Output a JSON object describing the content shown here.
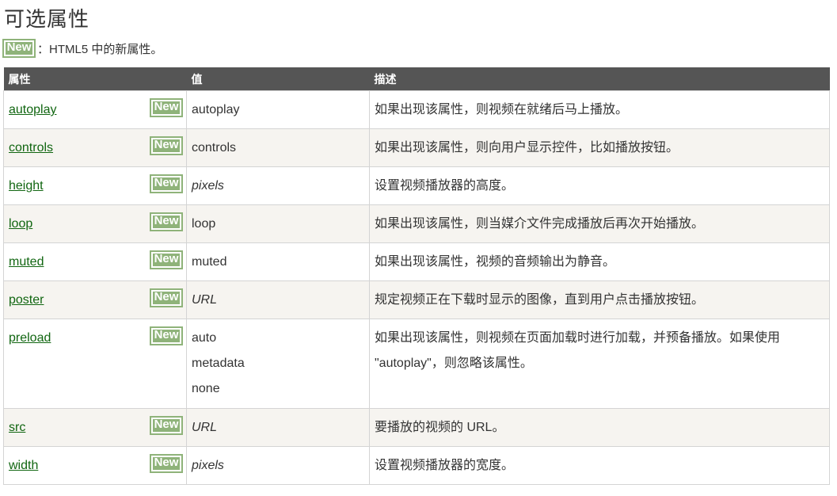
{
  "title": "可选属性",
  "note": {
    "badge": "New",
    "text": "：HTML5 中的新属性。"
  },
  "table": {
    "headers": [
      "属性",
      "值",
      "描述"
    ],
    "rows": [
      {
        "attr": "autoplay",
        "badge": "New",
        "values": [
          "autoplay"
        ],
        "italic": false,
        "desc": [
          "如果出现该属性，则视频在就绪后马上播放。"
        ]
      },
      {
        "attr": "controls",
        "badge": "New",
        "values": [
          "controls"
        ],
        "italic": false,
        "desc": [
          "如果出现该属性，则向用户显示控件，比如播放按钮。"
        ]
      },
      {
        "attr": "height",
        "badge": "New",
        "values": [
          "pixels"
        ],
        "italic": true,
        "desc": [
          "设置视频播放器的高度。"
        ]
      },
      {
        "attr": "loop",
        "badge": "New",
        "values": [
          "loop"
        ],
        "italic": false,
        "desc": [
          "如果出现该属性，则当媒介文件完成播放后再次开始播放。"
        ]
      },
      {
        "attr": "muted",
        "badge": "New",
        "values": [
          "muted"
        ],
        "italic": false,
        "desc": [
          "如果出现该属性，视频的音频输出为静音。"
        ]
      },
      {
        "attr": "poster",
        "badge": "New",
        "values": [
          "URL"
        ],
        "italic": true,
        "desc": [
          "规定视频正在下载时显示的图像，直到用户点击播放按钮。"
        ]
      },
      {
        "attr": "preload",
        "badge": "New",
        "values": [
          "auto",
          "metadata",
          "none"
        ],
        "italic": false,
        "desc": [
          "如果出现该属性，则视频在页面加载时进行加载，并预备播放。如果使用",
          "\"autoplay\"，则忽略该属性。"
        ]
      },
      {
        "attr": "src",
        "badge": "New",
        "values": [
          "URL"
        ],
        "italic": true,
        "desc": [
          "要播放的视频的 URL。"
        ]
      },
      {
        "attr": "width",
        "badge": "New",
        "values": [
          "pixels"
        ],
        "italic": true,
        "desc": [
          "设置视频播放器的宽度。"
        ]
      }
    ]
  }
}
